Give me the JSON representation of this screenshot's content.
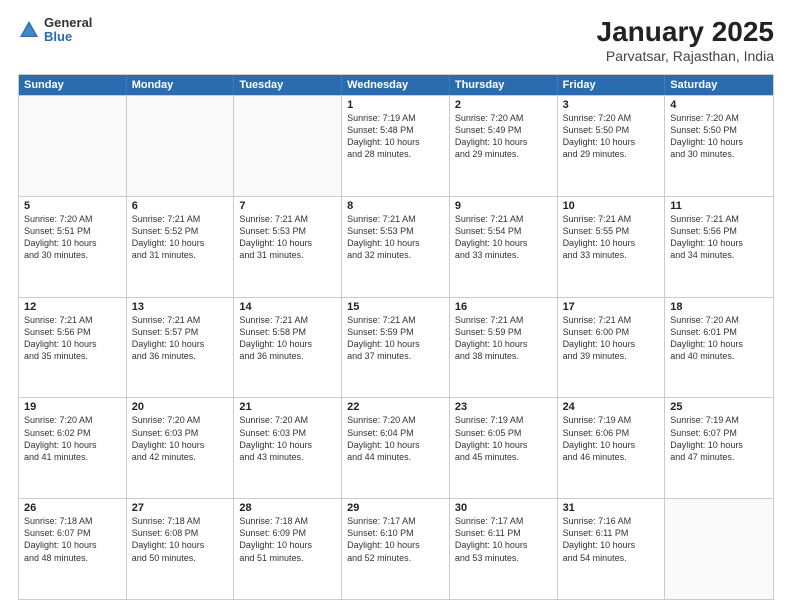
{
  "header": {
    "logo": {
      "general": "General",
      "blue": "Blue"
    },
    "title": "January 2025",
    "location": "Parvatsar, Rajasthan, India"
  },
  "weekdays": [
    "Sunday",
    "Monday",
    "Tuesday",
    "Wednesday",
    "Thursday",
    "Friday",
    "Saturday"
  ],
  "rows": [
    [
      {
        "day": "",
        "info": ""
      },
      {
        "day": "",
        "info": ""
      },
      {
        "day": "",
        "info": ""
      },
      {
        "day": "1",
        "info": "Sunrise: 7:19 AM\nSunset: 5:48 PM\nDaylight: 10 hours\nand 28 minutes."
      },
      {
        "day": "2",
        "info": "Sunrise: 7:20 AM\nSunset: 5:49 PM\nDaylight: 10 hours\nand 29 minutes."
      },
      {
        "day": "3",
        "info": "Sunrise: 7:20 AM\nSunset: 5:50 PM\nDaylight: 10 hours\nand 29 minutes."
      },
      {
        "day": "4",
        "info": "Sunrise: 7:20 AM\nSunset: 5:50 PM\nDaylight: 10 hours\nand 30 minutes."
      }
    ],
    [
      {
        "day": "5",
        "info": "Sunrise: 7:20 AM\nSunset: 5:51 PM\nDaylight: 10 hours\nand 30 minutes."
      },
      {
        "day": "6",
        "info": "Sunrise: 7:21 AM\nSunset: 5:52 PM\nDaylight: 10 hours\nand 31 minutes."
      },
      {
        "day": "7",
        "info": "Sunrise: 7:21 AM\nSunset: 5:53 PM\nDaylight: 10 hours\nand 31 minutes."
      },
      {
        "day": "8",
        "info": "Sunrise: 7:21 AM\nSunset: 5:53 PM\nDaylight: 10 hours\nand 32 minutes."
      },
      {
        "day": "9",
        "info": "Sunrise: 7:21 AM\nSunset: 5:54 PM\nDaylight: 10 hours\nand 33 minutes."
      },
      {
        "day": "10",
        "info": "Sunrise: 7:21 AM\nSunset: 5:55 PM\nDaylight: 10 hours\nand 33 minutes."
      },
      {
        "day": "11",
        "info": "Sunrise: 7:21 AM\nSunset: 5:56 PM\nDaylight: 10 hours\nand 34 minutes."
      }
    ],
    [
      {
        "day": "12",
        "info": "Sunrise: 7:21 AM\nSunset: 5:56 PM\nDaylight: 10 hours\nand 35 minutes."
      },
      {
        "day": "13",
        "info": "Sunrise: 7:21 AM\nSunset: 5:57 PM\nDaylight: 10 hours\nand 36 minutes."
      },
      {
        "day": "14",
        "info": "Sunrise: 7:21 AM\nSunset: 5:58 PM\nDaylight: 10 hours\nand 36 minutes."
      },
      {
        "day": "15",
        "info": "Sunrise: 7:21 AM\nSunset: 5:59 PM\nDaylight: 10 hours\nand 37 minutes."
      },
      {
        "day": "16",
        "info": "Sunrise: 7:21 AM\nSunset: 5:59 PM\nDaylight: 10 hours\nand 38 minutes."
      },
      {
        "day": "17",
        "info": "Sunrise: 7:21 AM\nSunset: 6:00 PM\nDaylight: 10 hours\nand 39 minutes."
      },
      {
        "day": "18",
        "info": "Sunrise: 7:20 AM\nSunset: 6:01 PM\nDaylight: 10 hours\nand 40 minutes."
      }
    ],
    [
      {
        "day": "19",
        "info": "Sunrise: 7:20 AM\nSunset: 6:02 PM\nDaylight: 10 hours\nand 41 minutes."
      },
      {
        "day": "20",
        "info": "Sunrise: 7:20 AM\nSunset: 6:03 PM\nDaylight: 10 hours\nand 42 minutes."
      },
      {
        "day": "21",
        "info": "Sunrise: 7:20 AM\nSunset: 6:03 PM\nDaylight: 10 hours\nand 43 minutes."
      },
      {
        "day": "22",
        "info": "Sunrise: 7:20 AM\nSunset: 6:04 PM\nDaylight: 10 hours\nand 44 minutes."
      },
      {
        "day": "23",
        "info": "Sunrise: 7:19 AM\nSunset: 6:05 PM\nDaylight: 10 hours\nand 45 minutes."
      },
      {
        "day": "24",
        "info": "Sunrise: 7:19 AM\nSunset: 6:06 PM\nDaylight: 10 hours\nand 46 minutes."
      },
      {
        "day": "25",
        "info": "Sunrise: 7:19 AM\nSunset: 6:07 PM\nDaylight: 10 hours\nand 47 minutes."
      }
    ],
    [
      {
        "day": "26",
        "info": "Sunrise: 7:18 AM\nSunset: 6:07 PM\nDaylight: 10 hours\nand 48 minutes."
      },
      {
        "day": "27",
        "info": "Sunrise: 7:18 AM\nSunset: 6:08 PM\nDaylight: 10 hours\nand 50 minutes."
      },
      {
        "day": "28",
        "info": "Sunrise: 7:18 AM\nSunset: 6:09 PM\nDaylight: 10 hours\nand 51 minutes."
      },
      {
        "day": "29",
        "info": "Sunrise: 7:17 AM\nSunset: 6:10 PM\nDaylight: 10 hours\nand 52 minutes."
      },
      {
        "day": "30",
        "info": "Sunrise: 7:17 AM\nSunset: 6:11 PM\nDaylight: 10 hours\nand 53 minutes."
      },
      {
        "day": "31",
        "info": "Sunrise: 7:16 AM\nSunset: 6:11 PM\nDaylight: 10 hours\nand 54 minutes."
      },
      {
        "day": "",
        "info": ""
      }
    ]
  ]
}
